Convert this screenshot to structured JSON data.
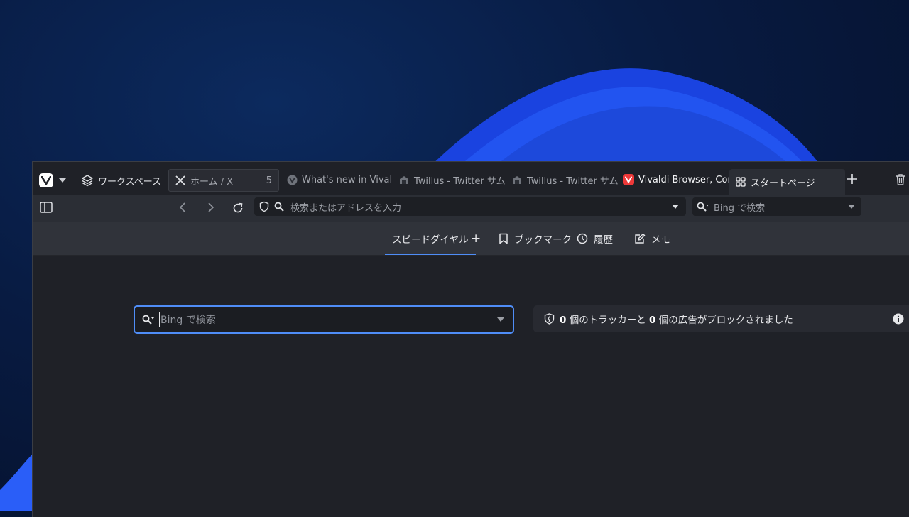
{
  "workspace": {
    "label": "ワークスペース"
  },
  "tabs": [
    {
      "title": "ホーム / X",
      "count": "5",
      "favicon": "x-icon"
    },
    {
      "title": "What's new in Vival",
      "favicon": "vivaldi-gray-icon"
    },
    {
      "title": "Twillus - Twitter サム",
      "favicon": "twillus-icon"
    },
    {
      "title": "Twillus - Twitter サム",
      "favicon": "twillus-icon"
    },
    {
      "title": "Vivaldi Browser, Cor",
      "favicon": "vivaldi-red-icon"
    },
    {
      "title": "スタートページ",
      "favicon": "grid-icon",
      "active": true
    }
  ],
  "address_bar": {
    "placeholder": "検索またはアドレスを入力",
    "search_placeholder": "Bing で検索"
  },
  "start_page_nav": {
    "speed_dial": "スピードダイヤル",
    "add": "+",
    "bookmarks": "ブックマーク",
    "history": "履歴",
    "notes": "メモ"
  },
  "content": {
    "search_placeholder": "Bing で検索",
    "tracker_count": "0",
    "tracker_text": "個のトラッカーと",
    "ad_count": "0",
    "ad_text": "個の広告がブロックされました"
  },
  "colors": {
    "accent": "#4f8df7",
    "window_bg": "#1f2127",
    "toolbar_bg": "#2b2e35"
  }
}
